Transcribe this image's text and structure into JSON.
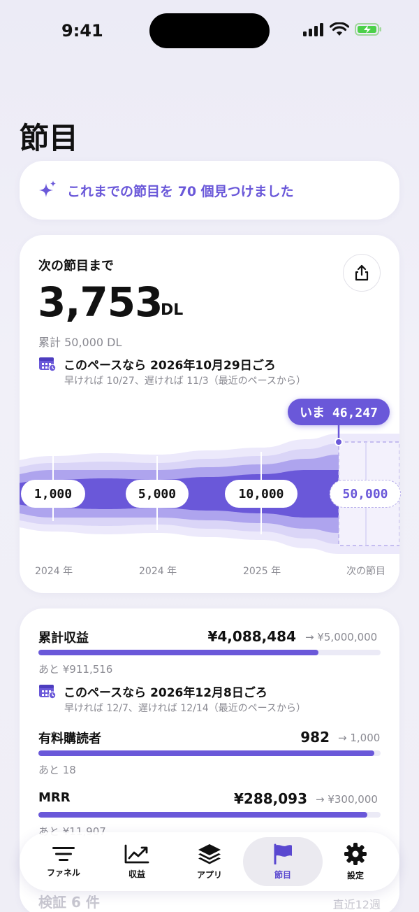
{
  "status": {
    "time": "9:41"
  },
  "page": {
    "title": "節目"
  },
  "banner": {
    "text": "これまでの節目を 70 個見つけました",
    "icon": "sparkles-icon"
  },
  "next_milestone": {
    "label": "次の節目まで",
    "remaining": "3,753",
    "unit": "DL",
    "total": "累計 50,000 DL",
    "forecast": "このペースなら 2026年10月29日ごろ",
    "forecast_range": "早ければ 10/27、遅ければ 11/3（最近のペースから）",
    "now_badge": "いま 46,247"
  },
  "chart_data": {
    "type": "area",
    "milestones": [
      {
        "value": "1,000",
        "x_label": "2024 年",
        "reached": true
      },
      {
        "value": "5,000",
        "x_label": "2024 年",
        "reached": true
      },
      {
        "value": "10,000",
        "x_label": "2025 年",
        "reached": true
      },
      {
        "value": "50,000",
        "x_label": "次の節目",
        "reached": false
      }
    ],
    "current": 46247,
    "colors": {
      "band_dark": "#6a58d9",
      "band_mid": "#aea4ee",
      "band_light": "#dad5f7",
      "band_lightest": "#ece9fb"
    }
  },
  "stats": [
    {
      "name": "累計収益",
      "value": "¥4,088,484",
      "target": "→ ¥5,000,000",
      "remaining": "あと ¥911,516",
      "progress": 0.8177,
      "forecast": "このペースなら 2026年12月8日ごろ",
      "forecast_range": "早ければ 12/7、遅ければ 12/14（最近のペースから）"
    },
    {
      "name": "有料購読者",
      "value": "982",
      "target": "→ 1,000",
      "remaining": "あと 18",
      "progress": 0.982
    },
    {
      "name": "MRR",
      "value": "¥288,093",
      "target": "→ ¥300,000",
      "remaining": "あと ¥11,907",
      "progress": 0.9603
    }
  ],
  "bottom_partial": {
    "left": "検証 6 件",
    "right": "直近12週"
  },
  "tabs": [
    {
      "label": "ファネル",
      "icon": "funnel-lines-icon"
    },
    {
      "label": "収益",
      "icon": "trend-chart-icon"
    },
    {
      "label": "アプリ",
      "icon": "layers-icon"
    },
    {
      "label": "節目",
      "icon": "flag-icon",
      "active": true
    },
    {
      "label": "設定",
      "icon": "gear-icon"
    }
  ]
}
